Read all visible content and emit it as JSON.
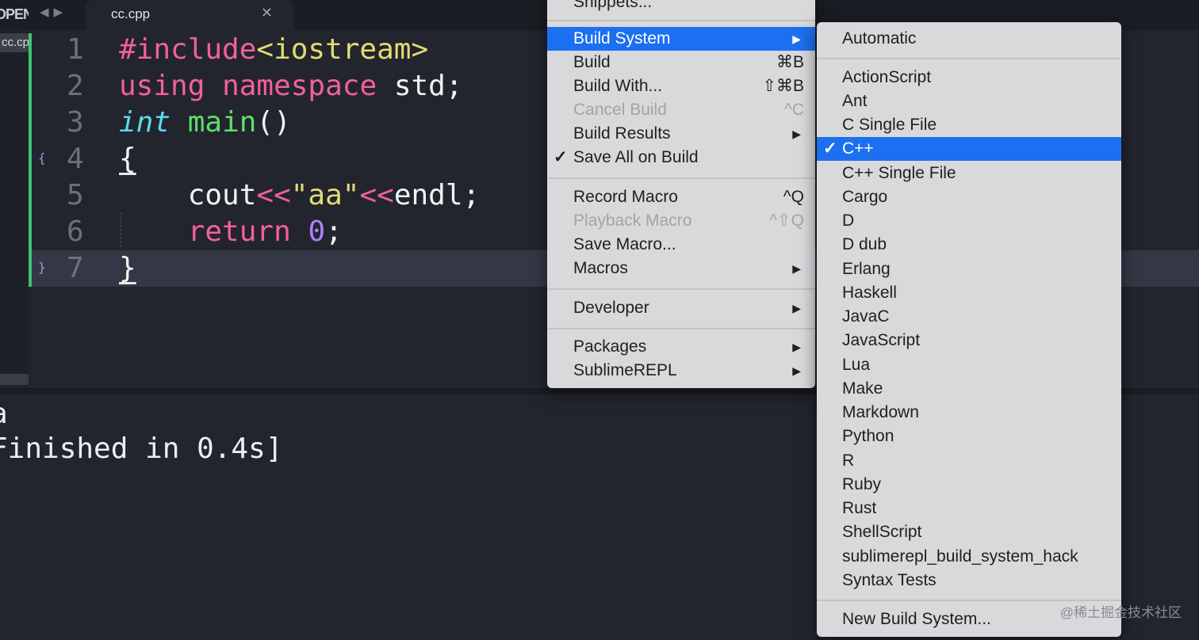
{
  "tabbar": {
    "open_label": "OPEN",
    "nav_back": "◀",
    "nav_forward": "▶",
    "active_tab": "cc.cpp",
    "close": "✕"
  },
  "sidebar": {
    "file": "cc.cpp"
  },
  "editor": {
    "line_numbers": [
      "1",
      "2",
      "3",
      "4",
      "5",
      "6",
      "7"
    ],
    "fold_open": "{",
    "fold_close": "}",
    "code": {
      "l1_a": "#include",
      "l1_b": "<iostream>",
      "l2_a": "using",
      "l2_b": "namespace",
      "l2_c": " std;",
      "l3_a": "int",
      "l3_b": "main",
      "l3_c": "()",
      "l4": "{",
      "l5_a": "    cout",
      "l5_b": "<<",
      "l5_c": "\"aa\"",
      "l5_d": "<<",
      "l5_e": "endl;",
      "l6_a": "    ",
      "l6_b": "return",
      "l6_c": " ",
      "l6_d": "0",
      "l6_e": ";",
      "l7": "}"
    }
  },
  "output": {
    "line1": "a",
    "line2": "Finished in 0.4s]"
  },
  "main_menu": {
    "top_item": "Snippets...",
    "items": [
      {
        "label": "Build System",
        "arrow": "▶",
        "selected": true
      },
      {
        "label": "Build",
        "shortcut": "⌘B"
      },
      {
        "label": "Build With...",
        "shortcut": "⇧⌘B"
      },
      {
        "label": "Cancel Build",
        "shortcut": "^C",
        "disabled": true
      },
      {
        "label": "Build Results",
        "arrow": "▶"
      },
      {
        "label": "Save All on Build",
        "check": "✓"
      },
      {
        "label": "Record Macro",
        "shortcut": "^Q"
      },
      {
        "label": "Playback Macro",
        "shortcut": "^⇧Q",
        "disabled": true
      },
      {
        "label": "Save Macro...",
        "shortcut": ""
      },
      {
        "label": "Macros",
        "arrow": "▶"
      },
      {
        "label": "Developer",
        "arrow": "▶"
      },
      {
        "label": "Packages",
        "arrow": "▶"
      },
      {
        "label": "SublimeREPL",
        "arrow": "▶"
      }
    ]
  },
  "build_system_menu": {
    "check": "✓",
    "items": [
      "Automatic",
      "ActionScript",
      "Ant",
      "C Single File",
      "C++",
      "C++ Single File",
      "Cargo",
      "D",
      "D dub",
      "Erlang",
      "Haskell",
      "JavaC",
      "JavaScript",
      "Lua",
      "Make",
      "Markdown",
      "Python",
      "R",
      "Ruby",
      "Rust",
      "ShellScript",
      "sublimerepl_build_system_hack",
      "Syntax Tests",
      "New Build System..."
    ],
    "selected": "C++"
  },
  "watermark": "@稀土掘金技术社区",
  "colors": {
    "editor_bg": "#22252e",
    "selection_blue": "#1c6ff0",
    "keyword_pink": "#f35fa0",
    "function_green": "#5ce06a",
    "string_yellow": "#e4db73",
    "type_cyan": "#62d8e9",
    "number_purple": "#ae81ff",
    "git_added_green": "#3ec46d"
  }
}
